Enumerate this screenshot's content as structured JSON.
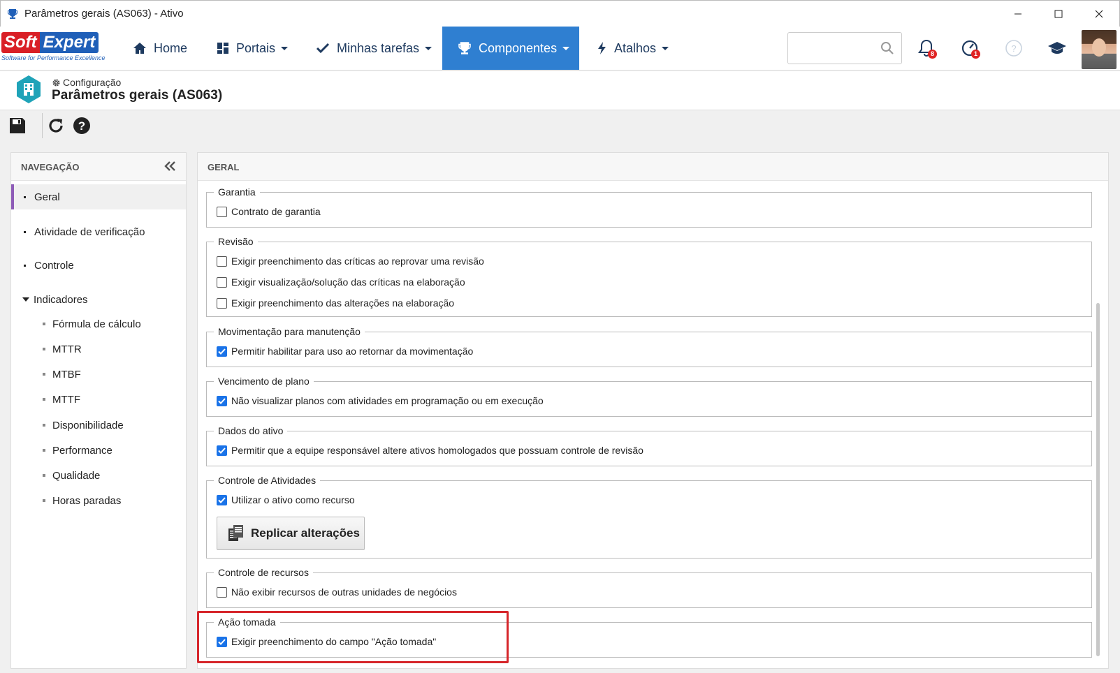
{
  "window": {
    "title": "Parâmetros gerais (AS063) - Ativo"
  },
  "brand": {
    "soft": "Soft",
    "expert": "Expert",
    "tagline": "Software for Performance Excellence",
    "colors": {
      "red": "#d91f26",
      "blue": "#1f5fb8",
      "accent": "#2f7fd1",
      "nav_selected": "#8e5cb7"
    }
  },
  "nav": {
    "home": "Home",
    "portais": "Portais",
    "tarefas": "Minhas tarefas",
    "componentes": "Componentes",
    "atalhos": "Atalhos"
  },
  "search": {
    "placeholder": ""
  },
  "badges": {
    "notifications": "8",
    "tasks": "1"
  },
  "header": {
    "breadcrumb": "Configuração",
    "title": "Parâmetros gerais (AS063)"
  },
  "left": {
    "heading": "NAVEGAÇÃO",
    "items": [
      {
        "label": "Geral"
      },
      {
        "label": "Atividade de verificação"
      },
      {
        "label": "Controle"
      },
      {
        "label": "Indicadores"
      }
    ],
    "subitems": [
      {
        "label": "Fórmula de cálculo"
      },
      {
        "label": "MTTR"
      },
      {
        "label": "MTBF"
      },
      {
        "label": "MTTF"
      },
      {
        "label": "Disponibilidade"
      },
      {
        "label": "Performance"
      },
      {
        "label": "Qualidade"
      },
      {
        "label": "Horas paradas"
      }
    ]
  },
  "main": {
    "heading": "GERAL",
    "groups": {
      "garantia": {
        "legend": "Garantia",
        "options": [
          "Contrato de garantia"
        ]
      },
      "revisao": {
        "legend": "Revisão",
        "options": [
          "Exigir preenchimento das críticas ao reprovar uma revisão",
          "Exigir visualização/solução das críticas na elaboração",
          "Exigir preenchimento das alterações na elaboração"
        ]
      },
      "movimentacao": {
        "legend": "Movimentação para manutenção",
        "options": [
          "Permitir habilitar para uso ao retornar da movimentação"
        ]
      },
      "vencimento": {
        "legend": "Vencimento de plano",
        "options": [
          "Não visualizar planos com atividades em programação ou em execução"
        ]
      },
      "dados": {
        "legend": "Dados do ativo",
        "options": [
          "Permitir que a equipe responsável altere ativos homologados que possuam controle de revisão"
        ]
      },
      "atividades": {
        "legend": "Controle de Atividades",
        "options": [
          "Utilizar o ativo como recurso"
        ],
        "button": "Replicar alterações"
      },
      "recursos": {
        "legend": "Controle de recursos",
        "options": [
          "Não exibir recursos de outras unidades de negócios"
        ]
      },
      "acao": {
        "legend": "Ação tomada",
        "options": [
          "Exigir preenchimento do campo \"Ação tomada\""
        ]
      }
    }
  }
}
